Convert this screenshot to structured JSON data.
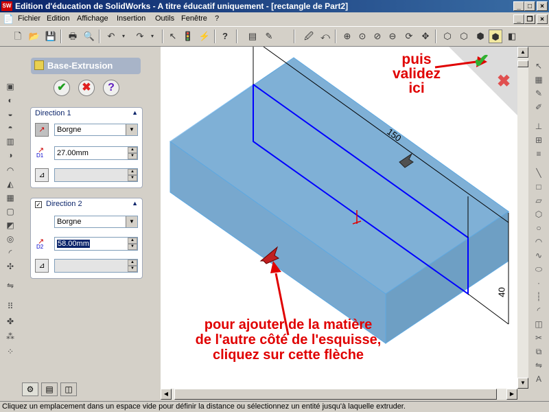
{
  "window": {
    "title": "Edition d'éducation de SolidWorks - A titre éducatif uniquement - [rectangle de Part2]",
    "logo_text": "SW"
  },
  "menu": {
    "items": [
      "Fichier",
      "Edition",
      "Affichage",
      "Insertion",
      "Outils",
      "Fenêtre",
      "?"
    ]
  },
  "property_manager": {
    "title": "Base-Extrusion",
    "ok_symbol": "✔",
    "cancel_symbol": "✖",
    "help_symbol": "?",
    "direction1": {
      "label": "Direction 1",
      "end_condition": "Borgne",
      "depth": "27.00mm",
      "depth_icon_label": "D1"
    },
    "direction2": {
      "label": "Direction 2",
      "checked": true,
      "end_condition": "Borgne",
      "depth": "58.00mm",
      "depth_icon_label": "D2"
    }
  },
  "viewport": {
    "dimension_length": "150",
    "dimension_height": "40",
    "box_color": "#7fb0d6",
    "sketch_color": "#0000ff"
  },
  "annotations": {
    "validate_lines": [
      "puis",
      "validez",
      "ici"
    ],
    "arrow_lines": [
      "pour ajouter de la matière",
      "de l'autre côté de l'esquisse,",
      "cliquez sur cette flèche"
    ],
    "color": "#e00000"
  },
  "status": {
    "text": "Cliquez un emplacement dans un espace vide pour définir la distance ou sélectionnez un entité jusqu'à laquelle extruder."
  }
}
